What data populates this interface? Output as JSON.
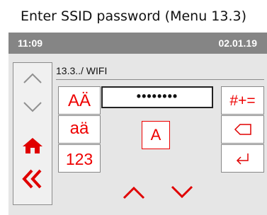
{
  "caption": "Enter SSID password (Menu 13.3)",
  "status": {
    "time": "11:09",
    "date": "02.01.19"
  },
  "breadcrumb": "13.3../ WIFI",
  "keyboard": {
    "uppercase_label": "AÄ",
    "lowercase_label": "aä",
    "numbers_label": "123",
    "symbols_label": "#+=",
    "current_char": "A"
  },
  "password_field": {
    "value": "••••••••"
  },
  "colors": {
    "accent": "#e00000",
    "statusbar": "#858585",
    "panel": "#e6e6e6"
  },
  "icons": [
    "chevron-up-icon",
    "chevron-down-icon",
    "home-icon",
    "double-chevron-left-icon",
    "backspace-icon",
    "enter-icon",
    "arrow-up-icon",
    "arrow-down-icon"
  ]
}
